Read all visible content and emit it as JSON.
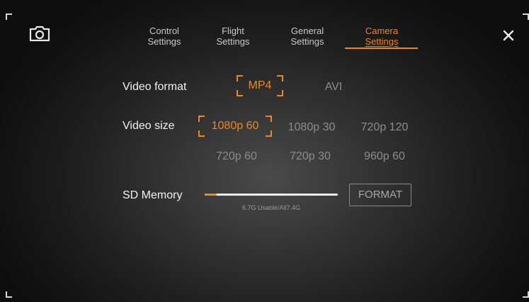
{
  "header": {
    "tabs": [
      {
        "line1": "Control",
        "line2": "Settings",
        "active": false
      },
      {
        "line1": "Flight",
        "line2": "Settings",
        "active": false
      },
      {
        "line1": "General",
        "line2": "Settings",
        "active": false
      },
      {
        "line1": "Camera",
        "line2": "Settings",
        "active": true
      }
    ]
  },
  "icons": {
    "camera": "camera-icon",
    "close": "close-icon"
  },
  "video_format": {
    "label": "Video format",
    "options": [
      "MP4",
      "AVI"
    ],
    "selected": "MP4"
  },
  "video_size": {
    "label": "Video size",
    "options": [
      "1080p 60",
      "1080p 30",
      "720p 120",
      "720p 60",
      "720p 30",
      "960p 60"
    ],
    "selected": "1080p 60"
  },
  "sd_memory": {
    "label": "SD Memory",
    "usage_text": "6.7G Usable/All7.4G",
    "used_fraction": 0.09,
    "format_label": "FORMAT"
  },
  "colors": {
    "accent": "#f0861f",
    "text": "#f2f2f2",
    "muted": "#8c8c8c"
  }
}
